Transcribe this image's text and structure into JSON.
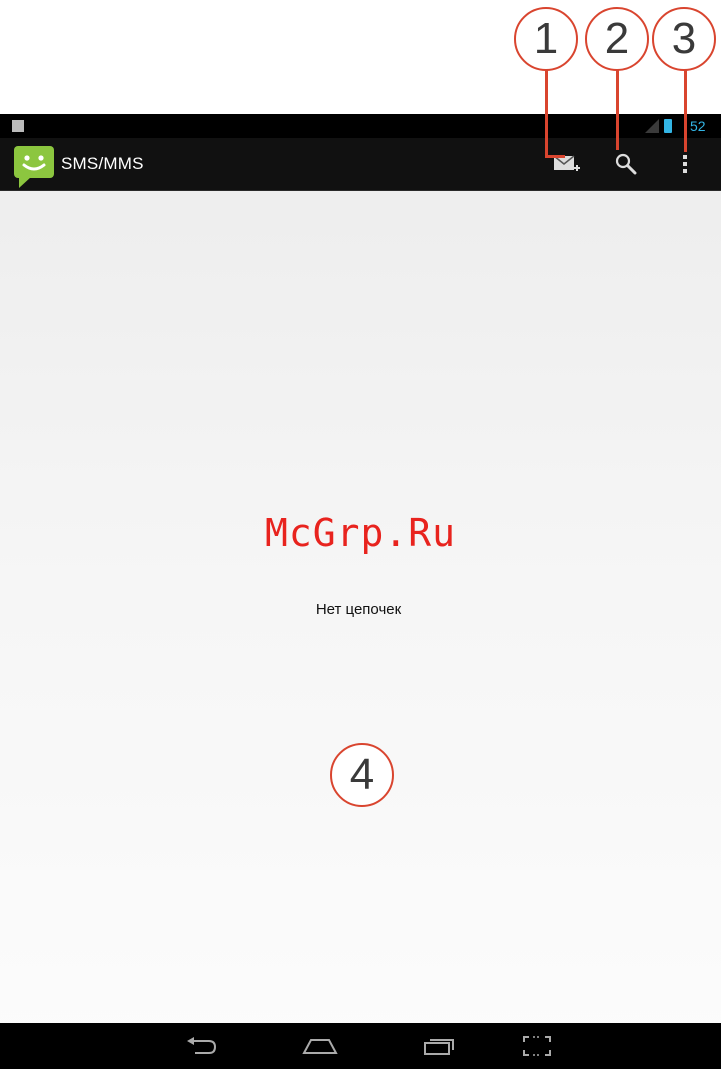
{
  "callouts": [
    "1",
    "2",
    "3",
    "4"
  ],
  "status_bar": {
    "time": "52",
    "accent_color": "#33b5e5"
  },
  "action_bar": {
    "app_icon": "sms-smiley-icon",
    "title": "SMS/MMS",
    "actions": [
      {
        "icon": "new-message-icon"
      },
      {
        "icon": "search-icon"
      },
      {
        "icon": "overflow-menu-icon"
      }
    ]
  },
  "content": {
    "watermark": "McGrp.Ru",
    "empty_message": "Нет цепочек"
  },
  "navigation_bar": {
    "buttons": [
      {
        "icon": "back-icon"
      },
      {
        "icon": "home-icon"
      },
      {
        "icon": "recent-apps-icon"
      },
      {
        "icon": "screenshot-icon"
      }
    ]
  },
  "colors": {
    "callout": "#d9452f",
    "watermark": "#e8231e",
    "app_icon": "#8cc63f"
  }
}
